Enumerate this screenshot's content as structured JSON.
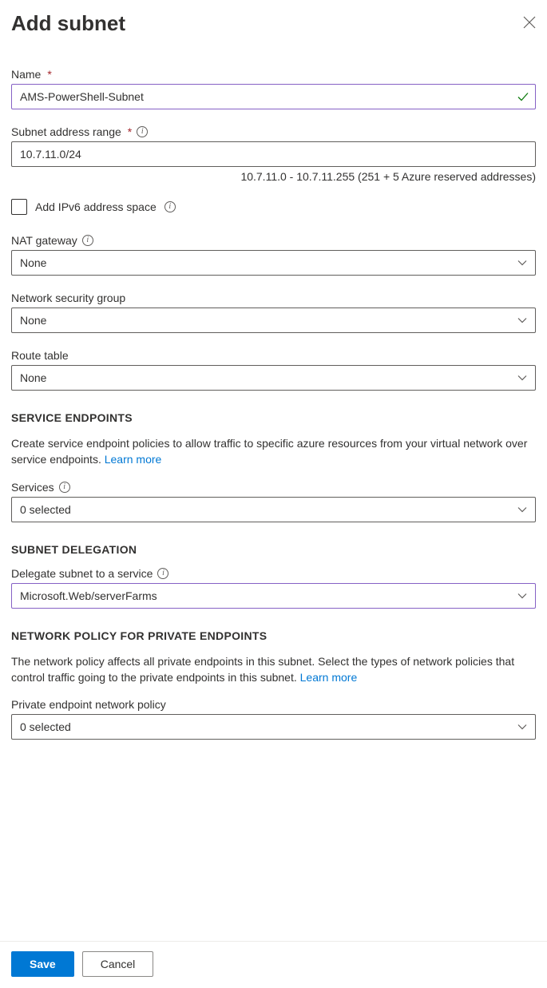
{
  "header": {
    "title": "Add subnet"
  },
  "fields": {
    "name": {
      "label": "Name",
      "value": "AMS-PowerShell-Subnet"
    },
    "range": {
      "label": "Subnet address range",
      "value": "10.7.11.0/24",
      "hint": "10.7.11.0 - 10.7.11.255 (251 + 5 Azure reserved addresses)"
    },
    "ipv6": {
      "label": "Add IPv6 address space"
    },
    "nat": {
      "label": "NAT gateway",
      "value": "None"
    },
    "nsg": {
      "label": "Network security group",
      "value": "None"
    },
    "route": {
      "label": "Route table",
      "value": "None"
    }
  },
  "serviceEndpoints": {
    "heading": "SERVICE ENDPOINTS",
    "desc": "Create service endpoint policies to allow traffic to specific azure resources from your virtual network over service endpoints. ",
    "learn": "Learn more",
    "services": {
      "label": "Services",
      "value": "0 selected"
    }
  },
  "delegation": {
    "heading": "SUBNET DELEGATION",
    "label": "Delegate subnet to a service",
    "value": "Microsoft.Web/serverFarms"
  },
  "networkPolicy": {
    "heading": "NETWORK POLICY FOR PRIVATE ENDPOINTS",
    "desc": "The network policy affects all private endpoints in this subnet. Select the types of network policies that control traffic going to the private endpoints in this subnet. ",
    "learn": "Learn more",
    "label": "Private endpoint network policy",
    "value": "0 selected"
  },
  "footer": {
    "save": "Save",
    "cancel": "Cancel"
  }
}
